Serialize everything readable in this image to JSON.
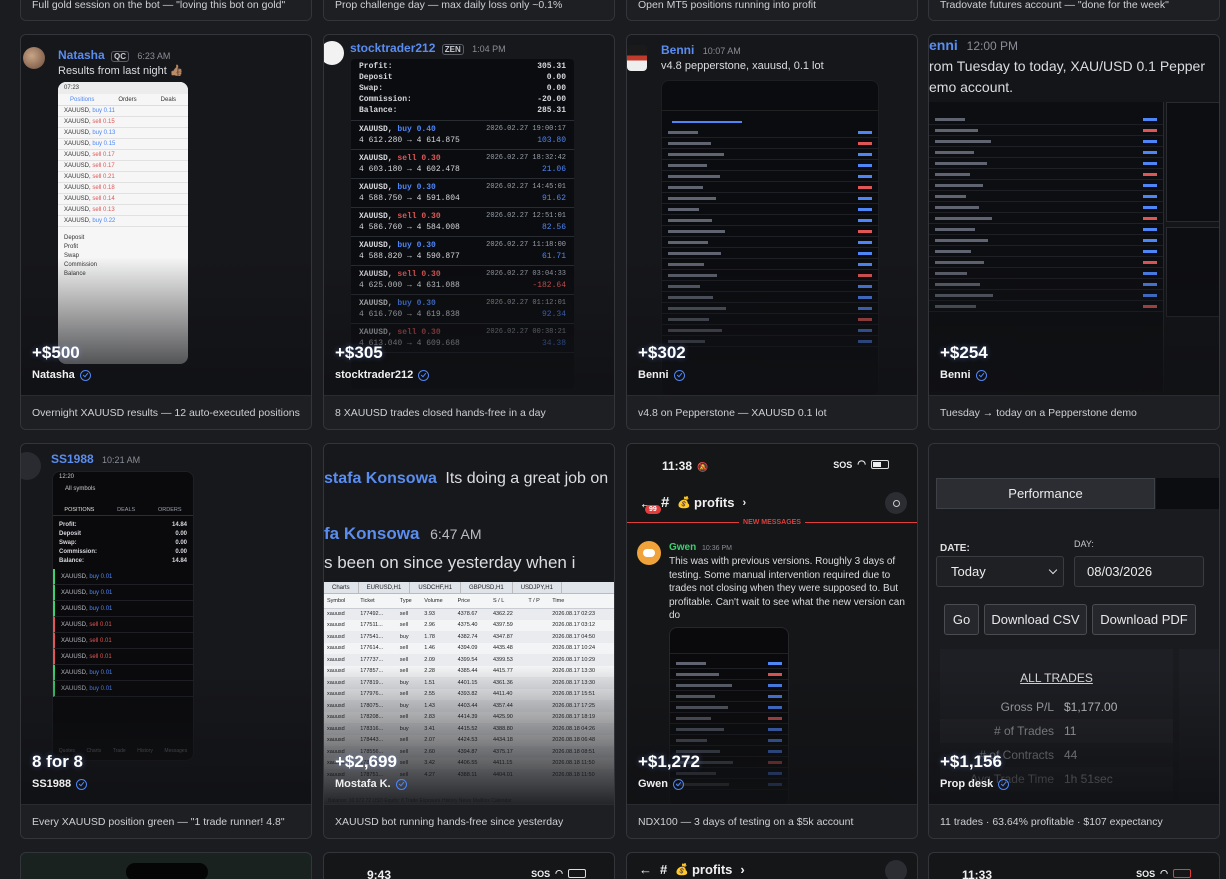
{
  "top_captions": [
    "Full gold session on the bot — \"loving this bot on gold\"",
    "Prop challenge day — max daily loss only ~0.1%",
    "Open MT5 positions running into profit",
    "Tradovate futures account — \"done for the week\""
  ],
  "cards": [
    {
      "amount": "+$500",
      "author": "Natasha",
      "caption": "Overnight XAUUSD results — 12 auto-executed positions",
      "msg_name": "Natasha",
      "msg_badge": "QC",
      "msg_time": "6:23 AM",
      "msg_text": "Results from last night 👍🏽",
      "phone_time": "07:23",
      "tabs": [
        "Positions",
        "Orders",
        "Deals"
      ],
      "trades": [
        {
          "sym": "XAUUSD",
          "side": "buy",
          "lot": "0.11"
        },
        {
          "sym": "XAUUSD",
          "side": "sell",
          "lot": "0.15"
        },
        {
          "sym": "XAUUSD",
          "side": "buy",
          "lot": "0.13"
        },
        {
          "sym": "XAUUSD",
          "side": "buy",
          "lot": "0.15"
        },
        {
          "sym": "XAUUSD",
          "side": "sell",
          "lot": "0.17"
        },
        {
          "sym": "XAUUSD",
          "side": "sell",
          "lot": "0.17"
        },
        {
          "sym": "XAUUSD",
          "side": "sell",
          "lot": "0.21"
        },
        {
          "sym": "XAUUSD",
          "side": "sell",
          "lot": "0.18"
        },
        {
          "sym": "XAUUSD",
          "side": "sell",
          "lot": "0.14"
        },
        {
          "sym": "XAUUSD",
          "side": "sell",
          "lot": "0.13"
        },
        {
          "sym": "XAUUSD",
          "side": "buy",
          "lot": "0.22"
        }
      ],
      "summary": [
        "Deposit",
        "Profit",
        "Swap",
        "Commission",
        "Balance"
      ]
    },
    {
      "amount": "+$305",
      "author": "stocktrader212",
      "caption": "8 XAUUSD trades closed hands-free in a day",
      "msg_name": "stocktrader212",
      "msg_badge": "ZEN",
      "msg_time": "1:04 PM",
      "summary": [
        {
          "label": "Profit:",
          "value": "305.31"
        },
        {
          "label": "Deposit",
          "value": "0.00"
        },
        {
          "label": "Swap:",
          "value": "0.00"
        },
        {
          "label": "Commission:",
          "value": "-20.00"
        },
        {
          "label": "Balance:",
          "value": "285.31"
        }
      ],
      "trades": [
        {
          "sym": "XAUUSD,",
          "side": "buy",
          "lot": "0.40",
          "date": "2026.02.27 19:00:17",
          "prices": "4 612.280 → 4 614.875",
          "pl": "103.80"
        },
        {
          "sym": "XAUUSD,",
          "side": "sell",
          "lot": "0.30",
          "date": "2026.02.27 18:32:42",
          "prices": "4 603.180 → 4 602.478",
          "pl": "21.06"
        },
        {
          "sym": "XAUUSD,",
          "side": "buy",
          "lot": "0.30",
          "date": "2026.02.27 14:45:01",
          "prices": "4 588.750 → 4 591.804",
          "pl": "91.62"
        },
        {
          "sym": "XAUUSD,",
          "side": "sell",
          "lot": "0.30",
          "date": "2026.02.27 12:51:01",
          "prices": "4 586.760 → 4 584.008",
          "pl": "82.56"
        },
        {
          "sym": "XAUUSD,",
          "side": "buy",
          "lot": "0.30",
          "date": "2026.02.27 11:18:00",
          "prices": "4 588.820 → 4 590.877",
          "pl": "61.71"
        },
        {
          "sym": "XAUUSD,",
          "side": "sell",
          "lot": "0.30",
          "date": "2026.02.27 03:04:33",
          "prices": "4 625.000 → 4 631.088",
          "pl": "-182.64"
        },
        {
          "sym": "XAUUSD,",
          "side": "buy",
          "lot": "0.30",
          "date": "2026.02.27 01:12:01",
          "prices": "4 616.760 → 4 619.838",
          "pl": "92.34"
        },
        {
          "sym": "XAUUSD,",
          "side": "sell",
          "lot": "0.30",
          "date": "2026.02.27 00:38:21",
          "prices": "4 613.040 → 4 609.668",
          "pl": "34.38"
        }
      ]
    },
    {
      "amount": "+$302",
      "author": "Benni",
      "caption": "v4.8 on Pepperstone — XAUUSD 0.1 lot",
      "msg_name": "Benni",
      "msg_time": "10:07 AM",
      "msg_text": "v4.8 pepperstone, xauusd, 0.1 lot"
    },
    {
      "amount": "+$254",
      "author": "Benni",
      "caption": "Tuesday → today on a Pepperstone demo",
      "msg_name": "enni",
      "msg_time": "12:00 PM",
      "msg_text_1": "rom Tuesday to today, XAU/USD 0.1 Pepper",
      "msg_text_2": "emo account."
    },
    {
      "amount": "8 for 8",
      "author": "SS1988",
      "caption": "Every XAUUSD position green — \"1 trade runner! 4.8\"",
      "msg_name": "SS1988",
      "msg_time": "10:21 AM",
      "phone_time": "12:20",
      "phone_title": "All symbols",
      "tabs": [
        "POSITIONS",
        "DEALS",
        "ORDERS"
      ],
      "summary": [
        {
          "label": "Profit:",
          "value": "14.84"
        },
        {
          "label": "Deposit",
          "value": "0.00"
        },
        {
          "label": "Swap:",
          "value": "0.00"
        },
        {
          "label": "Commission:",
          "value": "0.00"
        },
        {
          "label": "Balance:",
          "value": "14.84"
        }
      ],
      "trades": [
        {
          "sym": "XAUUSD,",
          "side": "buy",
          "lot": "0.01"
        },
        {
          "sym": "XAUUSD,",
          "side": "buy",
          "lot": "0.01"
        },
        {
          "sym": "XAUUSD,",
          "side": "buy",
          "lot": "0.01"
        },
        {
          "sym": "XAUUSD,",
          "side": "sell",
          "lot": "0.01"
        },
        {
          "sym": "XAUUSD,",
          "side": "sell",
          "lot": "0.01"
        },
        {
          "sym": "XAUUSD,",
          "side": "sell",
          "lot": "0.01"
        },
        {
          "sym": "XAUUSD,",
          "side": "buy",
          "lot": "0.01"
        },
        {
          "sym": "XAUUSD,",
          "side": "buy",
          "lot": "0.01"
        }
      ],
      "nav": [
        "Quotes",
        "Charts",
        "Trade",
        "History",
        "Messages"
      ]
    },
    {
      "amount": "+$2,699",
      "author": "Mostafa K.",
      "caption": "XAUUSD bot running hands-free since yesterday",
      "msg_line_1_name": "stafa Konsowa",
      "msg_line_1_text": "Its doing a great job on",
      "msg_name": "fa Konsowa",
      "msg_time": "6:47 AM",
      "msg_text": "s been on since yesterday when i",
      "table_tabs": [
        "Charts",
        "EURUSD,H1",
        "USDCHF,H1",
        "GBPUSD,H1",
        "USDJPY,H1"
      ],
      "table_headers": [
        "Symbol",
        "Ticket",
        "Type",
        "Volume",
        "Price",
        "S / L",
        "T / P",
        "Time"
      ],
      "table_rows": [
        [
          "xauusd",
          "177492...",
          "sell",
          "3.93",
          "4378.67",
          "4362.22",
          "",
          "2026.08.17 02:23"
        ],
        [
          "xauusd",
          "177511...",
          "sell",
          "2.96",
          "4375.40",
          "4397.59",
          "",
          "2026.08.17 03:12"
        ],
        [
          "xauusd",
          "177541...",
          "buy",
          "1.78",
          "4382.74",
          "4347.87",
          "",
          "2026.08.17 04:50"
        ],
        [
          "xauusd",
          "177614...",
          "sell",
          "1.46",
          "4394.09",
          "4435.48",
          "",
          "2026.08.17 10:24"
        ],
        [
          "xauusd",
          "177737...",
          "sell",
          "2.09",
          "4399.54",
          "4399.53",
          "",
          "2026.08.17 10:29"
        ],
        [
          "xauusd",
          "177857...",
          "sell",
          "2.28",
          "4385.44",
          "4415.77",
          "",
          "2026.08.17 13:30"
        ],
        [
          "xauusd",
          "177819...",
          "buy",
          "1.51",
          "4401.15",
          "4361.36",
          "",
          "2026.08.17 13:30"
        ],
        [
          "xauusd",
          "177976...",
          "sell",
          "2.55",
          "4393.82",
          "4411.40",
          "",
          "2026.08.17 15:51"
        ],
        [
          "xauusd",
          "178075...",
          "buy",
          "1.43",
          "4403.44",
          "4357.44",
          "",
          "2026.08.17 17:25"
        ],
        [
          "xauusd",
          "178208...",
          "sell",
          "2.83",
          "4414.39",
          "4425.90",
          "",
          "2026.08.17 18:19"
        ],
        [
          "xauusd",
          "178316...",
          "buy",
          "3.41",
          "4415.52",
          "4388.80",
          "",
          "2026.08.18 04:26"
        ],
        [
          "xauusd",
          "178443...",
          "sell",
          "2.07",
          "4424.53",
          "4434.18",
          "",
          "2026.08.18 06:48"
        ],
        [
          "xauusd",
          "178556...",
          "sell",
          "2.60",
          "4394.87",
          "4375.17",
          "",
          "2026.08.18 08:51"
        ],
        [
          "xauusd",
          "178661...",
          "sell",
          "3.42",
          "4406.55",
          "4411.15",
          "",
          "2026.08.18 11:50"
        ],
        [
          "xauusd",
          "178751...",
          "sell",
          "4.27",
          "4388.11",
          "4404.01",
          "",
          "2026.08.18 11:50"
        ]
      ],
      "footer_text": "Balance: 10 072.72 USD  Equity: 8 Trade  Exposure  History  News  Mailbox  Calendar"
    },
    {
      "amount": "+$1,272",
      "author": "Gwen",
      "caption": "NDX100 — 3 days of testing on a $5k account",
      "status_time": "11:38",
      "status_sos": "SOS",
      "channel": "profits",
      "channel_emoji": "💰",
      "unread": "99",
      "new_messages": "NEW MESSAGES",
      "msg_name": "Gwen",
      "msg_time": "10:36 PM",
      "msg_text": "This was with previous versions. Roughly 3 days of testing. Some manual intervention required due to trades not closing when they were supposed to. But profitable. Can't wait to see what the new version can do"
    },
    {
      "amount": "+$1,156",
      "author": "Prop desk",
      "caption": "11 trades · 63.64% profitable · $107 expectancy",
      "tab": "Performance",
      "date_label": "DATE:",
      "day_label": "DAY:",
      "date_value": "Today",
      "day_value": "08/03/2026",
      "buttons": [
        "Go",
        "Download CSV",
        "Download PDF"
      ],
      "section": "ALL TRADES",
      "stats": [
        {
          "label": "Gross P/L",
          "value": "$1,177.00"
        },
        {
          "label": "# of Trades",
          "value": "11"
        },
        {
          "label": "# of Contracts",
          "value": "44"
        },
        {
          "label": "Avg Trade Time",
          "value": "1h 51sec"
        }
      ]
    }
  ],
  "bottom_row": [
    {
      "time": "9:43",
      "sos": "SOS"
    },
    {
      "channel": "profits",
      "channel_emoji": "💰"
    },
    {
      "time": "11:33",
      "sos": "SOS"
    }
  ]
}
